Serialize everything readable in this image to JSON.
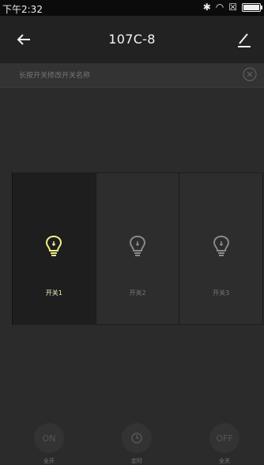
{
  "status_bar": {
    "time": "下午2:32",
    "icons": [
      "bluetooth-icon",
      "wifi-icon",
      "sim-icon",
      "battery-icon"
    ]
  },
  "header": {
    "title": "107C-8"
  },
  "hint": {
    "text": "长按开关修改开关名称"
  },
  "switches": [
    {
      "label": "开关1",
      "state": "on"
    },
    {
      "label": "开关2",
      "state": "off"
    },
    {
      "label": "开关3",
      "state": "off"
    }
  ],
  "bottom": {
    "on_icon_text": "ON",
    "on_label": "全开",
    "timer_label": "定时",
    "off_icon_text": "OFF",
    "off_label": "全关"
  },
  "colors": {
    "on_bulb": "#f4f08a",
    "off_bulb": "#8a8a8a",
    "background": "#2b2b2b"
  }
}
